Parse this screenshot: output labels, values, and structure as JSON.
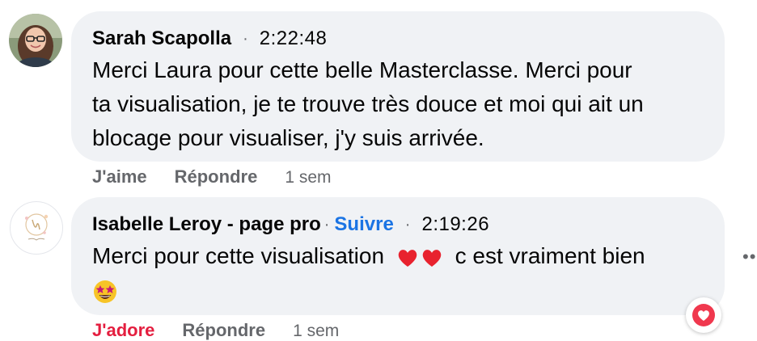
{
  "comments": [
    {
      "author": "Sarah Scapolla",
      "separator": "·",
      "time": "2:22:48",
      "text_lines": [
        "Merci Laura pour cette belle Masterclasse. Merci pour",
        "ta visualisation, je te trouve très douce et moi qui ait un",
        "blocage pour visualiser, j'y suis arrivée."
      ],
      "actions": {
        "react": "J'aime",
        "reply": "Répondre",
        "age": "1 sem"
      }
    },
    {
      "author": "Isabelle Leroy - page pro",
      "separator": "·",
      "follow": "Suivre",
      "separator2": "·",
      "time": "2:19:26",
      "text": "Merci pour cette visualisation",
      "text_after": "c est vraiment bien",
      "emojis": [
        "red-heart",
        "red-heart",
        "star-struck"
      ],
      "actions": {
        "react": "J'adore",
        "reply": "Répondre",
        "age": "1 sem"
      },
      "reaction": "love"
    }
  ],
  "more_options": "••",
  "colors": {
    "bubble": "#f0f2f5",
    "action": "#65676b",
    "follow": "#1b74e4",
    "love": "#e41e3f"
  }
}
